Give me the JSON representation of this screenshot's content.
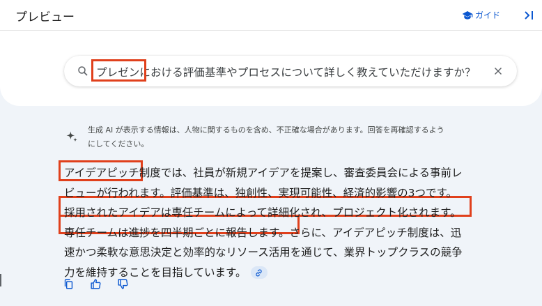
{
  "header": {
    "title": "プレビュー",
    "guide_label": "ガイド"
  },
  "search": {
    "query": "プレゼンにおける評価基準やプロセスについて詳しく教えていただけますか？"
  },
  "disclaimer": {
    "line1": "生成 AI が表示する情報は、人物に関するものを含め、不正確な場合があります。回答を再確認するよう",
    "line2": "にしてください。"
  },
  "answer": {
    "lines": [
      "アイデアピッチ制度では、社員が新規アイデアを提案し、審査委員会による事前レ",
      "ビューが行われます。評価基準は、独創性、実現可能性、経済的影響の3つです。",
      "採用されたアイデアは専任チームによって詳細化され、プロジェクト化されます。",
      "専任チームは進捗を四半期ごとに報告します。さらに、アイデアピッチ制度は、迅",
      "速かつ柔軟な意思決定と効率的なリソース活用を通じて、業界トップクラスの競争",
      "力を維持することを目指しています。"
    ]
  },
  "colors": {
    "accent": "#0b57d0",
    "highlight": "#e0401c",
    "background": "#f0f4f9"
  }
}
